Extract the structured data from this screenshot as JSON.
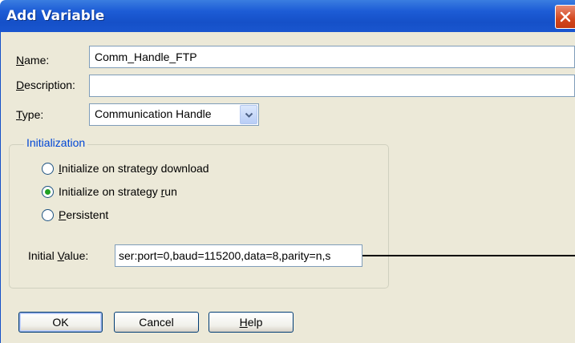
{
  "window": {
    "title": "Add Variable"
  },
  "fields": {
    "name": {
      "label_access": "N",
      "label_rest": "ame:",
      "value": "Comm_Handle_FTP"
    },
    "description": {
      "label_access": "D",
      "label_rest": "escription:",
      "value": ""
    },
    "type": {
      "label_access": "T",
      "label_rest": "ype:",
      "value": "Communication Handle"
    }
  },
  "initialization": {
    "title": "Initialization",
    "options": [
      {
        "pre": "",
        "access": "I",
        "post": "nitialize on strategy download",
        "selected": false
      },
      {
        "pre": "Initialize on strategy ",
        "access": "r",
        "post": "un",
        "selected": true
      },
      {
        "pre": "",
        "access": "P",
        "post": "ersistent",
        "selected": false
      }
    ],
    "initial_value": {
      "label_pre": "Initial ",
      "label_access": "V",
      "label_post": "alue:",
      "value": "ser:port=0,baud=115200,data=8,parity=n,s"
    }
  },
  "buttons": {
    "ok": "OK",
    "cancel": "Cancel",
    "help_access": "H",
    "help_rest": "elp"
  },
  "icons": {
    "close": "close-icon",
    "dropdown": "chevron-down-icon"
  },
  "colors": {
    "titlebar": "#1550c8",
    "panel": "#ece9d8",
    "group_title": "#0046d5",
    "radio_selected": "#21a121"
  }
}
